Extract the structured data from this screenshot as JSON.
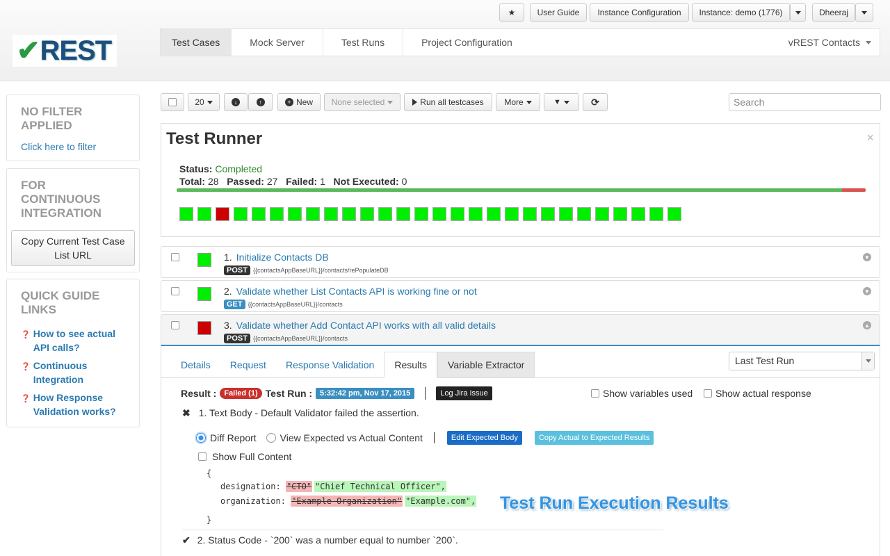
{
  "header": {
    "star_label": "★",
    "user_guide": "User Guide",
    "instance_config": "Instance Configuration",
    "instance": "Instance: demo (1776)",
    "user": "Dheeraj",
    "logo_check": "✔",
    "logo_text": "REST",
    "nav": [
      "Test Cases",
      "Mock Server",
      "Test Runs",
      "Project Configuration"
    ],
    "project": "vREST Contacts"
  },
  "sidebar": {
    "filter_title": "NO FILTER APPLIED",
    "filter_link": "Click here to filter",
    "ci_title": "FOR CONTINUOUS INTEGRATION",
    "copy_button": "Copy Current Test Case List URL",
    "guide_title": "QUICK GUIDE LINKS",
    "guide_links": [
      "How to see actual API calls?",
      "Continuous Integration",
      "How Response Validation works?"
    ]
  },
  "toolbar": {
    "page_size": "20",
    "new_label": "New",
    "none_selected": "None selected",
    "run_all": "Run all testcases",
    "more": "More",
    "search_placeholder": "Search"
  },
  "runner": {
    "title": "Test Runner",
    "status_label": "Status:",
    "status": "Completed",
    "total_label": "Total:",
    "total": "28",
    "passed_label": "Passed:",
    "passed": "27",
    "failed_label": "Failed:",
    "failed": "1",
    "notexec_label": "Not Executed:",
    "notexec": "0",
    "passed_fraction": 0.966,
    "results": [
      "pass",
      "pass",
      "fail",
      "pass",
      "pass",
      "pass",
      "pass",
      "pass",
      "pass",
      "pass",
      "pass",
      "pass",
      "pass",
      "pass",
      "pass",
      "pass",
      "pass",
      "pass",
      "pass",
      "pass",
      "pass",
      "pass",
      "pass",
      "pass",
      "pass",
      "pass",
      "pass",
      "pass"
    ],
    "colors": {
      "pass": "#00ee00",
      "fail": "#cc0000",
      "bar_pass": "#5cb85c",
      "bar_fail": "#d9534f"
    }
  },
  "testcases": [
    {
      "num": "1.",
      "title": "Initialize Contacts DB",
      "method": "POST",
      "url": "{{contactsAppBaseURL}}/contacts/rePopulateDB",
      "status": "pass"
    },
    {
      "num": "2.",
      "title": "Validate whether List Contacts API is working fine or not",
      "method": "GET",
      "url": "{{contactsAppBaseURL}}/contacts",
      "status": "pass"
    },
    {
      "num": "3.",
      "title": "Validate whether Add Contact API works with all valid details",
      "method": "POST",
      "url": "{{contactsAppBaseURL}}/contacts",
      "status": "fail"
    }
  ],
  "detail": {
    "tabs": [
      "Details",
      "Request",
      "Response Validation",
      "Results",
      "Variable Extractor"
    ],
    "run_select": "Last Test Run",
    "result_label": "Result :",
    "result_value": "Failed (1)",
    "testrun_label": "Test Run :",
    "testrun_value": "5:32:42 pm, Nov 17, 2015",
    "log_jira": "Log Jira Issue",
    "show_vars": "Show variables used",
    "show_actual": "Show actual response",
    "assert1": "1. Text Body - Default Validator failed the assertion.",
    "diff_report": "Diff Report",
    "view_expected": "View Expected vs Actual Content",
    "edit_expected": "Edit Expected Body",
    "copy_actual": "Copy Actual to Expected Results",
    "show_full": "Show Full Content",
    "brace_open": "{",
    "brace_close": "}",
    "line1_key": "designation:",
    "line1_old": "\"CTO\"",
    "line1_new": "\"Chief Technical Officer\",",
    "line2_key": "organization:",
    "line2_old": "\"Example Organization\"",
    "line2_new": "\"Example.com\",",
    "assert2": "2. Status Code - `200` was a number equal to number `200`.",
    "fail_mark": "✖",
    "pass_mark": "✔"
  },
  "overlay": "Test Run Execution Results"
}
